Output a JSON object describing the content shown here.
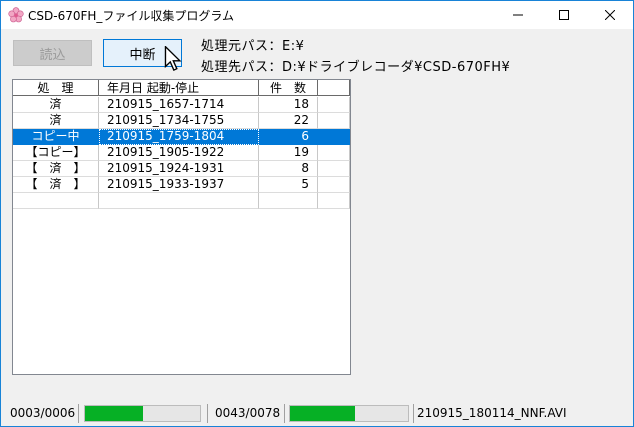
{
  "window": {
    "title": "CSD-670FH_ファイル収集プログラム",
    "minimize": "—",
    "maximize": "☐",
    "close": "✕"
  },
  "toolbar": {
    "read_label": "読込",
    "stop_label": "中断"
  },
  "paths": {
    "source": "処理元パス：E:¥",
    "dest": "処理先パス：D:¥ドライブレコーダ¥CSD-670FH¥"
  },
  "table": {
    "headers": [
      "処　理",
      "年月日 起動-停止",
      "件　数",
      ""
    ],
    "rows": [
      {
        "status": "済",
        "range": "210915_1657-1714",
        "count": "18"
      },
      {
        "status": "済",
        "range": "210915_1734-1755",
        "count": "22"
      },
      {
        "status": "コピー中",
        "range": "210915_1759-1804",
        "count": "6"
      },
      {
        "status": "【コピー】",
        "range": "210915_1905-1922",
        "count": "19"
      },
      {
        "status": "【　済　】",
        "range": "210915_1924-1931",
        "count": "8"
      },
      {
        "status": "【　済　】",
        "range": "210915_1933-1937",
        "count": "5"
      },
      {
        "status": "",
        "range": "",
        "count": ""
      }
    ],
    "selected_index": 2
  },
  "status": {
    "group_counter": "0003/0006",
    "group_progress": 0.5,
    "file_counter": "0043/0078",
    "file_progress": 0.55,
    "current_file": "210915_180114_NNF.AVI"
  },
  "colors": {
    "selection": "#0078d7",
    "progress": "#06b025",
    "focus_border": "#0078d7"
  }
}
